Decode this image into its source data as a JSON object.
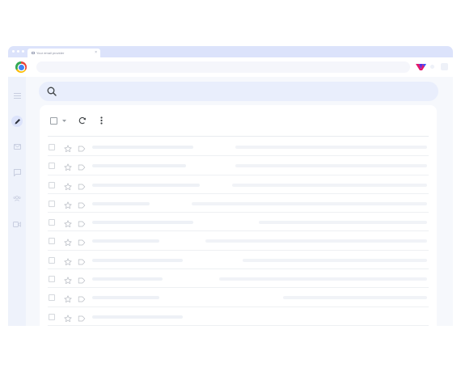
{
  "browser": {
    "tab_title": "Your email provider",
    "tab_close_glyph": "×",
    "colors": {
      "frame": "#dce3fb",
      "omnibox": "#f5f6fb"
    },
    "extension_icon": "brand-extension-icon"
  },
  "sidebar": {
    "items": [
      {
        "icon": "menu-icon"
      },
      {
        "icon": "compose-pencil-icon",
        "active": true
      },
      {
        "icon": "mail-icon"
      },
      {
        "icon": "chat-icon"
      },
      {
        "icon": "spaces-people-icon"
      },
      {
        "icon": "meet-video-icon"
      }
    ]
  },
  "search": {
    "icon": "search-icon",
    "placeholder": ""
  },
  "mail_toolbar": {
    "select_all": {
      "icon": "checkbox-icon"
    },
    "select_menu": {
      "icon": "caret-down-icon"
    },
    "refresh": {
      "icon": "refresh-icon"
    },
    "more": {
      "icon": "more-vertical-icon"
    }
  },
  "email_rows": [
    {
      "sender_fraction": 0.3,
      "subject_fraction": 0.57,
      "read": false
    },
    {
      "sender_fraction": 0.28,
      "subject_fraction": 0.57,
      "read": false
    },
    {
      "sender_fraction": 0.32,
      "subject_fraction": 0.58,
      "read": false
    },
    {
      "sender_fraction": 0.17,
      "subject_fraction": 0.7,
      "read": false
    },
    {
      "sender_fraction": 0.3,
      "subject_fraction": 0.5,
      "read": false
    },
    {
      "sender_fraction": 0.2,
      "subject_fraction": 0.66,
      "read": false
    },
    {
      "sender_fraction": 0.27,
      "subject_fraction": 0.55,
      "read": false
    },
    {
      "sender_fraction": 0.21,
      "subject_fraction": 0.62,
      "read": false
    },
    {
      "sender_fraction": 0.2,
      "subject_fraction": 0.43,
      "read": false
    },
    {
      "sender_fraction": 0.27,
      "subject_fraction": 0.0,
      "read": false
    }
  ]
}
